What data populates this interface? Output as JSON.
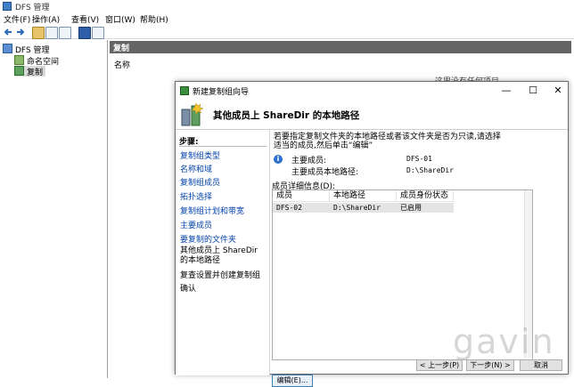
{
  "window": {
    "title": "DFS 管理"
  },
  "menu": [
    "文件(F)",
    "操作(A)",
    "查看(V)",
    "窗口(W)",
    "帮助(H)"
  ],
  "tree": {
    "root": "DFS 管理",
    "items": [
      "命名空间",
      "复制"
    ]
  },
  "right_pane": {
    "header": "复制",
    "column_name": "名称",
    "obscured_text": "这里没有任何项目"
  },
  "wizard": {
    "title": "新建复制组向导",
    "heading": "其他成员上 ShareDir 的本地路径",
    "steps_title": "步骤:",
    "steps": [
      {
        "label": "复制组类型",
        "state": "link"
      },
      {
        "label": "名称和域",
        "state": "link"
      },
      {
        "label": "复制组成员",
        "state": "link"
      },
      {
        "label": "拓扑选择",
        "state": "link"
      },
      {
        "label": "复制组计划和带宽",
        "state": "link"
      },
      {
        "label": "主要成员",
        "state": "link"
      },
      {
        "label": "要复制的文件夹",
        "state": "link"
      },
      {
        "label": "其他成员上 ShareDir 的本地路径",
        "state": "current"
      },
      {
        "label": "复查设置并创建复制组",
        "state": "plain"
      },
      {
        "label": "确认",
        "state": "plain"
      }
    ],
    "description": "若要指定复制文件夹的本地路径或者该文件夹是否为只读,请选择适当的成员,然后单击“编辑”",
    "primary_member_label": "主要成员:",
    "primary_member_value": "DFS-01",
    "primary_path_label": "主要成员本地路径:",
    "primary_path_value": "D:\\ShareDir",
    "members_label": "成员详细信息(D):",
    "table": {
      "headers": [
        "成员",
        "本地路径",
        "成员身份状态"
      ],
      "rows": [
        [
          "DFS-02",
          "D:\\ShareDir",
          "已启用"
        ]
      ]
    },
    "edit_button": "编辑(E)...",
    "buttons": {
      "back": "< 上一步(P)",
      "next": "下一步(N) >",
      "cancel": "取消"
    }
  },
  "watermark": "gavin"
}
